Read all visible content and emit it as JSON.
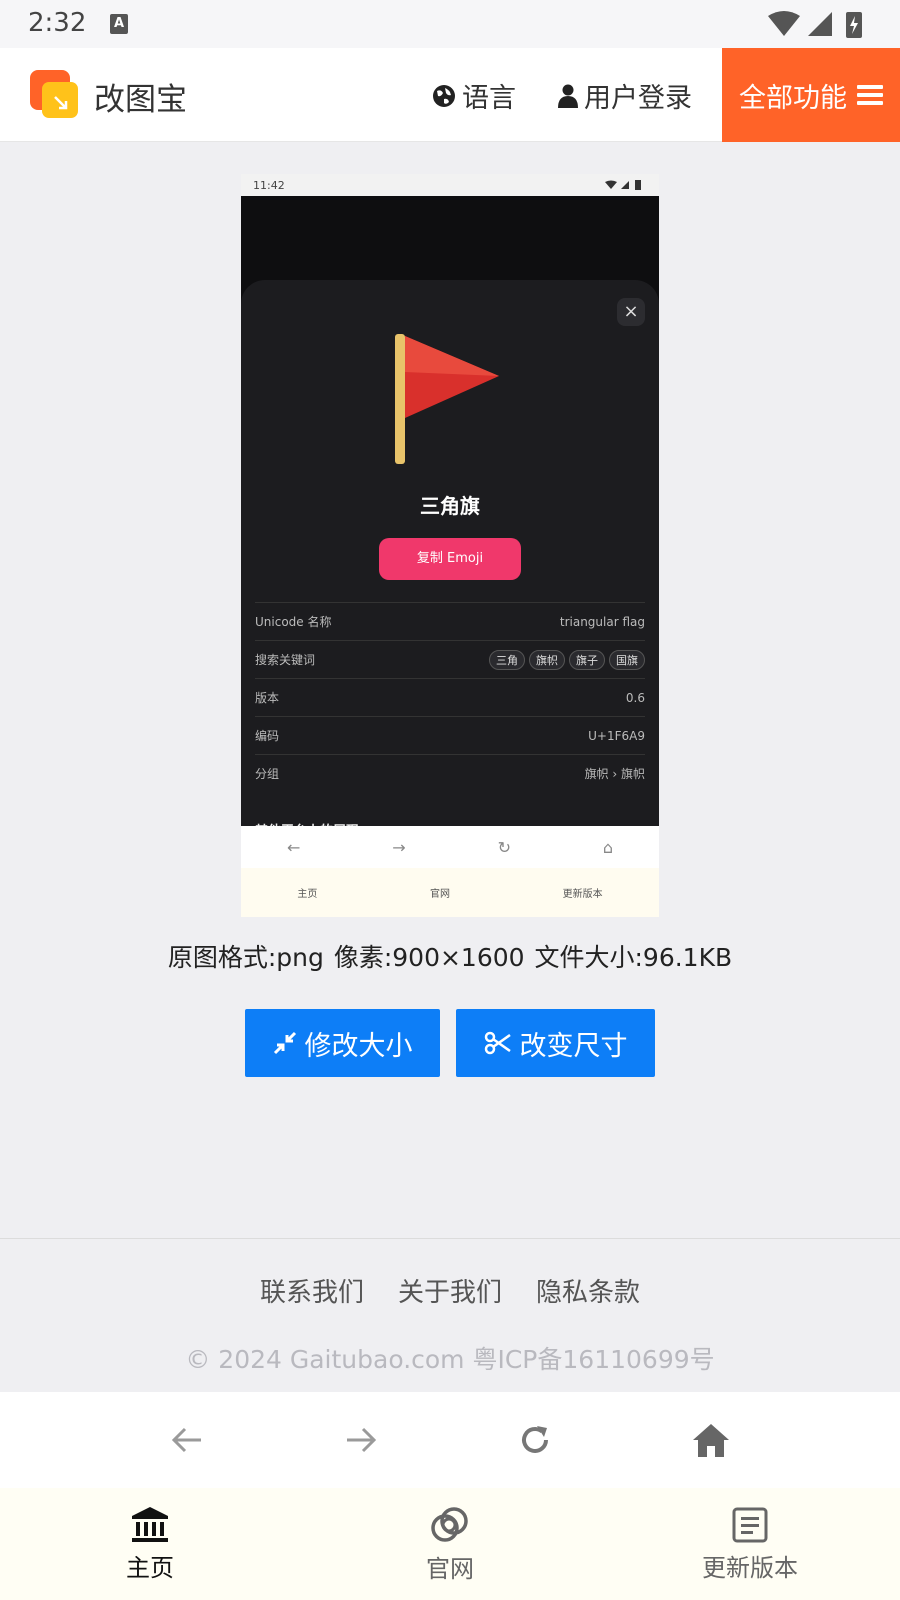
{
  "status_bar": {
    "time": "2:32",
    "notification_icon": "A"
  },
  "header": {
    "brand": "改图宝",
    "language": "语言",
    "login": "用户登录",
    "all_features": "全部功能"
  },
  "preview": {
    "status_time": "11:42",
    "emoji_title": "三角旗",
    "copy_button": "复制 Emoji",
    "rows": [
      {
        "label": "Unicode 名称",
        "value": "triangular flag"
      },
      {
        "label": "搜索关键词",
        "tags": [
          "三角",
          "旗帜",
          "旗子",
          "国旗"
        ]
      },
      {
        "label": "版本",
        "value": "0.6"
      },
      {
        "label": "编码",
        "value": "U+1F6A9"
      },
      {
        "label": "分组",
        "value": "旗帜 › 旗帜"
      }
    ],
    "other_platforms": "其他平台上的展现",
    "tabs": [
      "主页",
      "官网",
      "更新版本"
    ]
  },
  "image_info": "原图格式:png  像素:900×1600  文件大小:96.1KB",
  "buttons": {
    "resize": "修改大小",
    "crop": "改变尺寸"
  },
  "colors": {
    "accent_orange": "#ff6328",
    "primary_blue": "#0d7ef7"
  },
  "footer": {
    "links": [
      "联系我们",
      "关于我们",
      "隐私条款"
    ],
    "copyright": "© 2024 Gaitubao.com 粤ICP备16110699号"
  },
  "bottom_tabs": [
    {
      "label": "主页",
      "icon": "bank-icon"
    },
    {
      "label": "官网",
      "icon": "rings-icon"
    },
    {
      "label": "更新版本",
      "icon": "document-icon"
    }
  ]
}
